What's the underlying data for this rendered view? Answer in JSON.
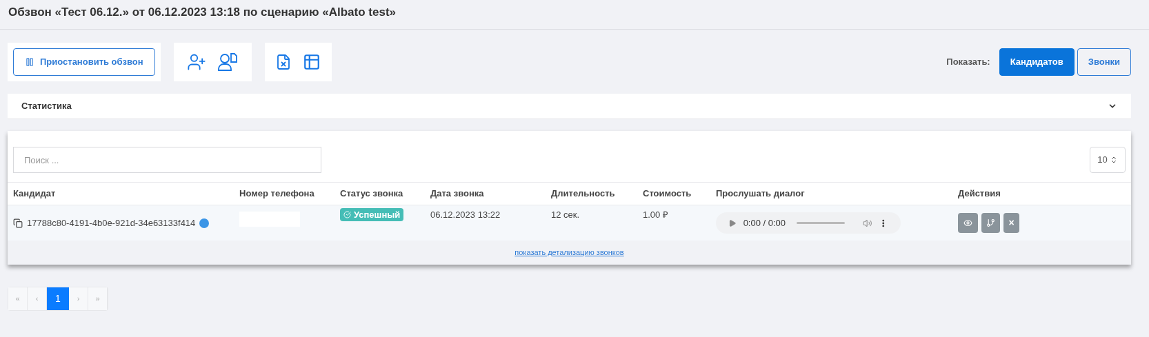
{
  "title": "Обзвон «Тест 06.12.» от 06.12.2023 13:18 по сценарию «Albato test»",
  "pause_button": "Приостановить обзвон",
  "show": {
    "label": "Показать:",
    "options": [
      {
        "label": "Кандидатов",
        "selected": true
      },
      {
        "label": "Звонки",
        "selected": false
      }
    ]
  },
  "statistics": {
    "title": "Статистика",
    "expanded": false
  },
  "search": {
    "placeholder": "Поиск ..."
  },
  "page_size": "10",
  "table": {
    "columns": [
      "Кандидат",
      "Номер телефона",
      "Статус звонка",
      "Дата звонка",
      "Длительность",
      "Стоимость",
      "Прослушать диалог",
      "Действия"
    ],
    "rows": [
      {
        "candidate": "17788c80-4191-4b0e-921d-34e63133f414",
        "status": "Успешный",
        "date": "06.12.2023 13:22",
        "duration": "12 сек.",
        "cost": "1.00 ₽",
        "player_time": "0:00 / 0:00",
        "action_close": "×"
      }
    ]
  },
  "details_link": "показать детализацию звонков",
  "pagination": [
    {
      "label": "«",
      "selected": false
    },
    {
      "label": "‹",
      "selected": false
    },
    {
      "label": "1",
      "selected": true
    },
    {
      "label": "›",
      "selected": false
    },
    {
      "label": "»",
      "selected": false
    }
  ]
}
